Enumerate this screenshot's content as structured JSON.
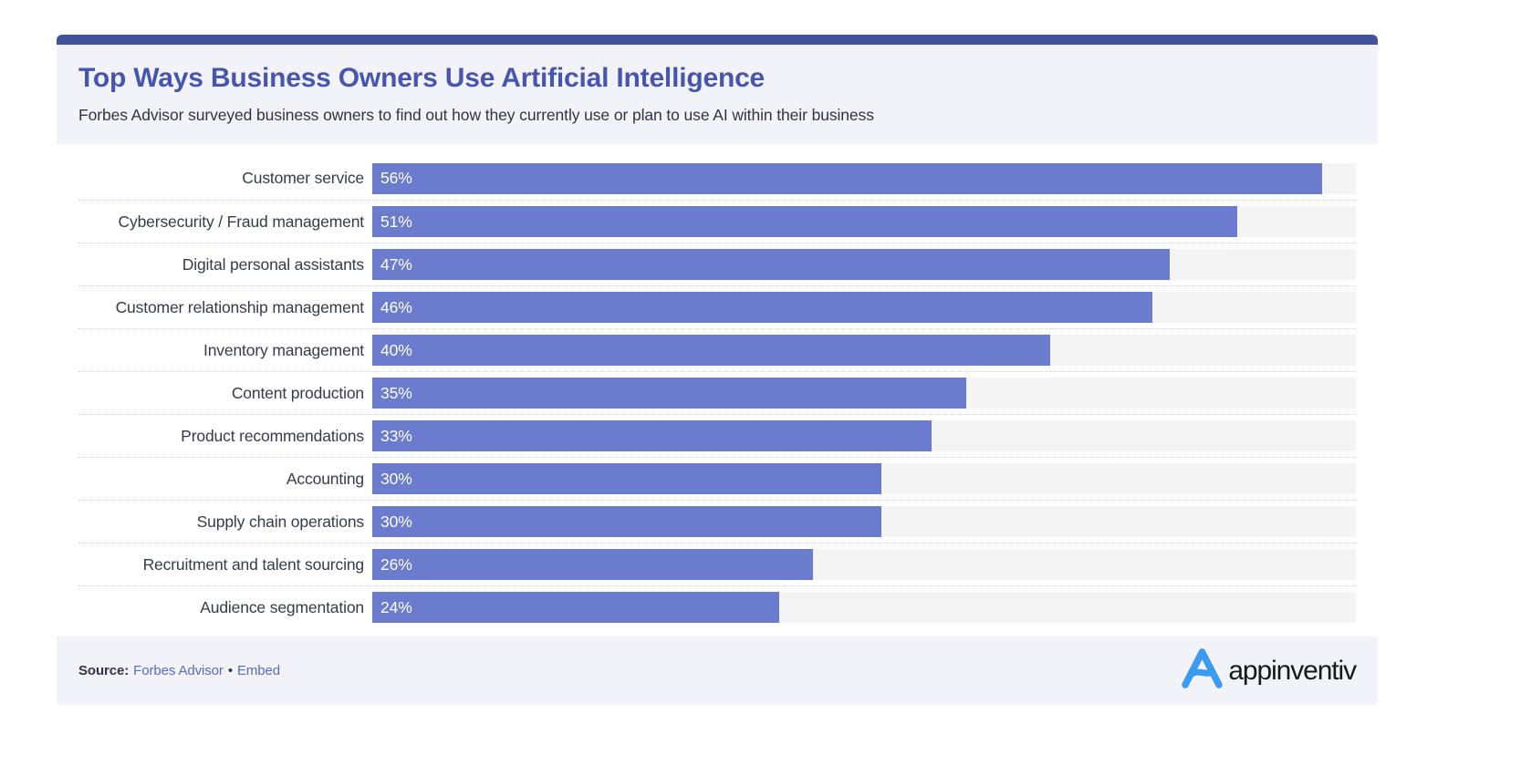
{
  "header": {
    "title": "Top Ways Business Owners Use Artificial Intelligence",
    "subtitle": "Forbes Advisor surveyed business owners to find out how they currently use or plan to use AI within their business",
    "accent_color": "#41529C",
    "title_color": "#4656B0",
    "background": "#F1F3F8"
  },
  "footer": {
    "source_label": "Source:",
    "source_name": "Forbes Advisor",
    "separator": "•",
    "embed_label": "Embed",
    "link_color": "#5B6BBF",
    "logo_name": "appinventiv",
    "logo_mark_color": "#3B9BF0",
    "logo_text_color": "#16181D"
  },
  "chart_data": {
    "type": "bar",
    "orientation": "horizontal",
    "title": "Top Ways Business Owners Use Artificial Intelligence",
    "subtitle": "Forbes Advisor surveyed business owners to find out how they currently use or plan to use AI within their business",
    "xlabel": "",
    "ylabel": "",
    "xlim": [
      0,
      58
    ],
    "grid": false,
    "legend": "none",
    "bar_color": "#6B7BCD",
    "track_color": "#F4F4F5",
    "value_suffix": "%",
    "categories": [
      "Customer service",
      "Cybersecurity / Fraud management",
      "Digital personal assistants",
      "Customer relationship management",
      "Inventory management",
      "Content production",
      "Product recommendations",
      "Accounting",
      "Supply chain operations",
      "Recruitment and talent sourcing",
      "Audience segmentation"
    ],
    "values": [
      56,
      51,
      47,
      46,
      40,
      35,
      33,
      30,
      30,
      26,
      24
    ],
    "value_labels": [
      "56%",
      "51%",
      "47%",
      "46%",
      "40%",
      "35%",
      "33%",
      "30%",
      "30%",
      "26%",
      "24%"
    ],
    "rows": [
      {
        "label": "Customer service",
        "value": 56,
        "value_label": "56%"
      },
      {
        "label": "Cybersecurity / Fraud management",
        "value": 51,
        "value_label": "51%"
      },
      {
        "label": "Digital personal assistants",
        "value": 47,
        "value_label": "47%"
      },
      {
        "label": "Customer relationship management",
        "value": 46,
        "value_label": "46%"
      },
      {
        "label": "Inventory management",
        "value": 40,
        "value_label": "40%"
      },
      {
        "label": "Content production",
        "value": 35,
        "value_label": "35%"
      },
      {
        "label": "Product recommendations",
        "value": 33,
        "value_label": "33%"
      },
      {
        "label": "Accounting",
        "value": 30,
        "value_label": "30%"
      },
      {
        "label": "Supply chain operations",
        "value": 30,
        "value_label": "30%"
      },
      {
        "label": "Recruitment and talent sourcing",
        "value": 26,
        "value_label": "26%"
      },
      {
        "label": "Audience segmentation",
        "value": 24,
        "value_label": "24%"
      }
    ]
  }
}
